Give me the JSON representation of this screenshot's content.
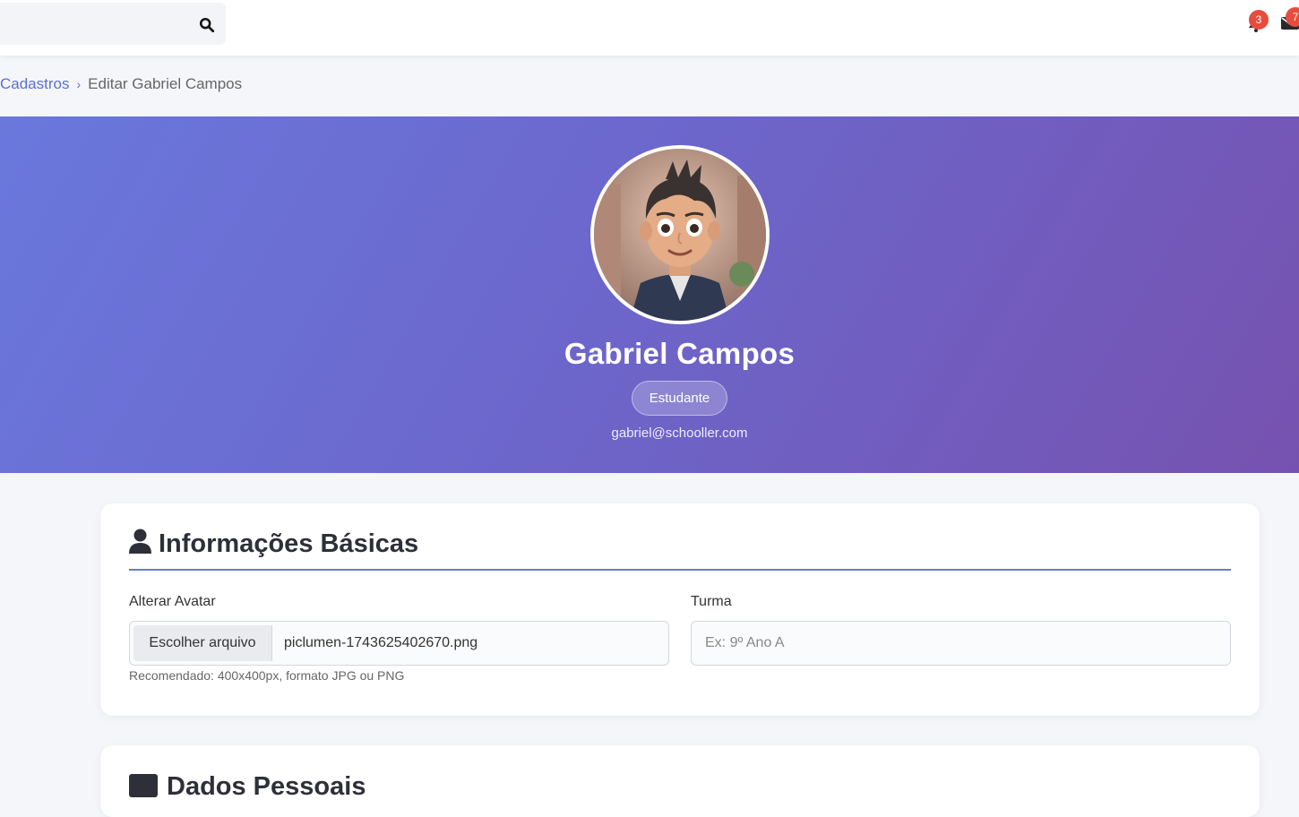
{
  "header": {
    "search": {
      "value": "",
      "placeholder": ""
    },
    "notifications_count": "3",
    "messages_count": "7"
  },
  "breadcrumb": {
    "parent": "Cadastros",
    "separator": "›",
    "current": "Editar Gabriel Campos"
  },
  "profile": {
    "name": "Gabriel Campos",
    "role": "Estudante",
    "email": "gabriel@schooller.com"
  },
  "basic_info": {
    "title": "Informações Básicas",
    "avatar_label": "Alterar Avatar",
    "file_button": "Escolher arquivo",
    "file_name": "piclumen-1743625402670.png",
    "avatar_hint": "Recomendado: 400x400px, formato JPG ou PNG",
    "class_label": "Turma",
    "class_placeholder": "Ex: 9º Ano A",
    "class_value": ""
  },
  "personal_info": {
    "title": "Dados Pessoais"
  },
  "colors": {
    "accent": "#6a78dc",
    "gradient_start": "#6a78dc",
    "gradient_end": "#7652b0",
    "badge": "#e74c3c"
  }
}
